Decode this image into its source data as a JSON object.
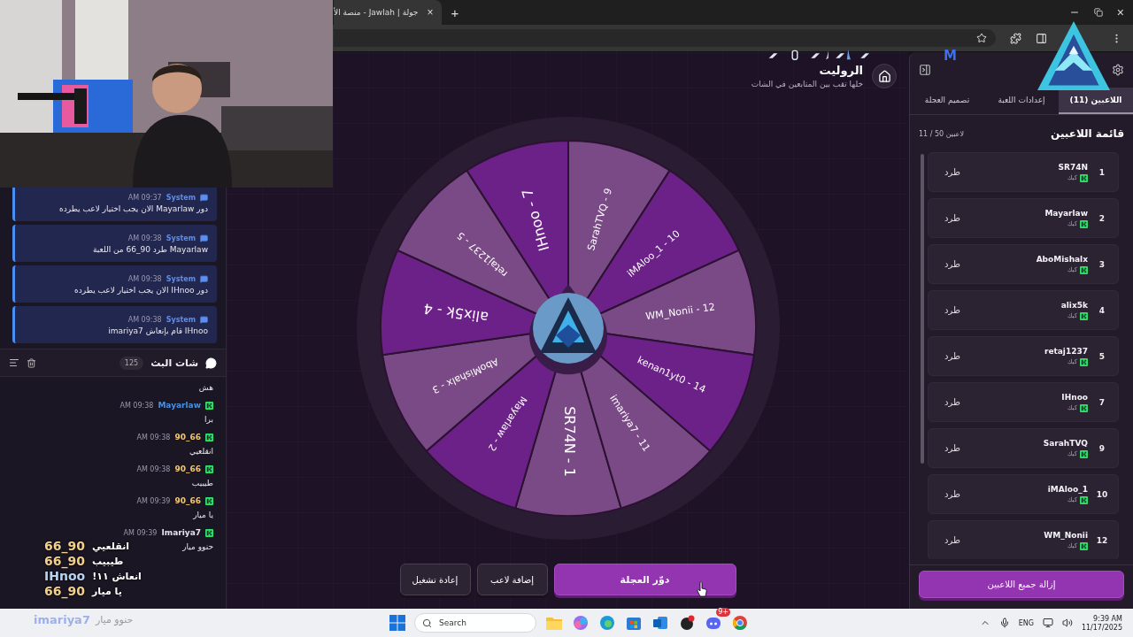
{
  "browser": {
    "tab_title": "جولة | Jawlah - منصة الأ",
    "tab_close": "×",
    "new_tab": "+",
    "window_close": "×"
  },
  "overlay": {
    "mark": "M",
    "chat_lines": [
      {
        "user": "66_90",
        "text": "انقلعيي",
        "color": "#f2d08c"
      },
      {
        "user": "66_90",
        "text": "طيبيب",
        "color": "#f2d08c"
      },
      {
        "user": "IHnoo",
        "text": "انعاش ١١!",
        "color": "#b8d4f4"
      },
      {
        "user": "66_90",
        "text": "يا ميار",
        "color": "#f2d08c"
      }
    ],
    "footer": {
      "user": "imariya7",
      "text": "حنوو ميار"
    }
  },
  "header": {
    "title": "الروليت",
    "subtitle": "خلها تقب بين المتابعين في الشات"
  },
  "wheel": {
    "segments": [
      {
        "label": "SR74N - 1",
        "color": "#7a4a86"
      },
      {
        "label": "Mayarlaw - 2",
        "color": "#6c2189"
      },
      {
        "label": "AboMishalx - 3",
        "color": "#7a4a86"
      },
      {
        "label": "alix5k - 4",
        "color": "#6c2189"
      },
      {
        "label": "retaj1237 - 5",
        "color": "#7a4a86"
      },
      {
        "label": "IHnoo - 7",
        "color": "#6c2189"
      },
      {
        "label": "SarahTVQ - 9",
        "color": "#7a4a86"
      },
      {
        "label": "iMAloo_1 - 10",
        "color": "#6c2189"
      },
      {
        "label": "WM_Nonii - 12",
        "color": "#7a4a86"
      },
      {
        "label": "kenan1yt0 - 14",
        "color": "#6c2189"
      },
      {
        "label": "imariya7 - 11",
        "color": "#7a4a86"
      }
    ]
  },
  "actions": [
    {
      "label": "دوّر العجلة",
      "kind": "primary"
    },
    {
      "label": "إضافة لاعب",
      "kind": "secondary"
    },
    {
      "label": "إعادة تشغيل",
      "kind": "secondary"
    }
  ],
  "panel": {
    "tabs": [
      {
        "label": "اللاعبين (11)",
        "selected": true
      },
      {
        "label": "إعدادات اللعبة",
        "selected": false
      },
      {
        "label": "تصميم العجلة",
        "selected": false
      }
    ],
    "list_title": "قائمة اللاعبين",
    "count": "11 / 50 لاعبين",
    "players": [
      {
        "number": "1",
        "name": "SR74N",
        "platform": "كيك",
        "action": "طرد"
      },
      {
        "number": "2",
        "name": "Mayarlaw",
        "platform": "كيك",
        "action": "طرد"
      },
      {
        "number": "3",
        "name": "AboMishalx",
        "platform": "كيك",
        "action": "طرد"
      },
      {
        "number": "4",
        "name": "alix5k",
        "platform": "كيك",
        "action": "طرد"
      },
      {
        "number": "5",
        "name": "retaj1237",
        "platform": "كيك",
        "action": "طرد"
      },
      {
        "number": "7",
        "name": "IHnoo",
        "platform": "كيك",
        "action": "طرد"
      },
      {
        "number": "9",
        "name": "SarahTVQ",
        "platform": "كيك",
        "action": "طرد"
      },
      {
        "number": "10",
        "name": "iMAloo_1",
        "platform": "كيك",
        "action": "طرد"
      },
      {
        "number": "12",
        "name": "WM_Nonii",
        "platform": "كيك",
        "action": "طرد"
      }
    ],
    "clear_button": "إزالة جميع اللاعبين"
  },
  "chat": {
    "system_messages": [
      {
        "author": "System",
        "time": "AM 09:37",
        "text": "دور Mayarlaw الان يجب اختيار لاعب يطرده"
      },
      {
        "author": "System",
        "time": "AM 09:38",
        "text": "Mayarlaw طرد 90_66 من اللعبة"
      },
      {
        "author": "System",
        "time": "AM 09:38",
        "text": "دور IHnoo الان يجب اختيار لاعب يطرده"
      },
      {
        "author": "System",
        "time": "AM 09:38",
        "text": "IHnoo قام بإنعاش imariya7"
      }
    ],
    "title": "شات البث",
    "count": "125",
    "messages": [
      {
        "text": "هش"
      },
      {
        "author": "Mayarlaw",
        "time": "AM 09:38",
        "text": "برا",
        "color": "#4a8fe0"
      },
      {
        "author": "90_66",
        "time": "AM 09:38",
        "text": "انقلعيي",
        "color": "#f0c874"
      },
      {
        "author": "90_66",
        "time": "AM 09:38",
        "text": "طيبيب",
        "color": "#f0c874"
      },
      {
        "author": "90_66",
        "time": "AM 09:39",
        "text": "يا ميار",
        "color": "#f0c874"
      },
      {
        "author": "Imariya7",
        "time": "AM 09:39",
        "text": "حنوو ميار",
        "color": "#e4e2f0"
      }
    ]
  },
  "taskbar": {
    "search_placeholder": "Search",
    "badge": "9+",
    "language": "ENG",
    "time": "9:39 AM",
    "date": "11/17/2025"
  }
}
